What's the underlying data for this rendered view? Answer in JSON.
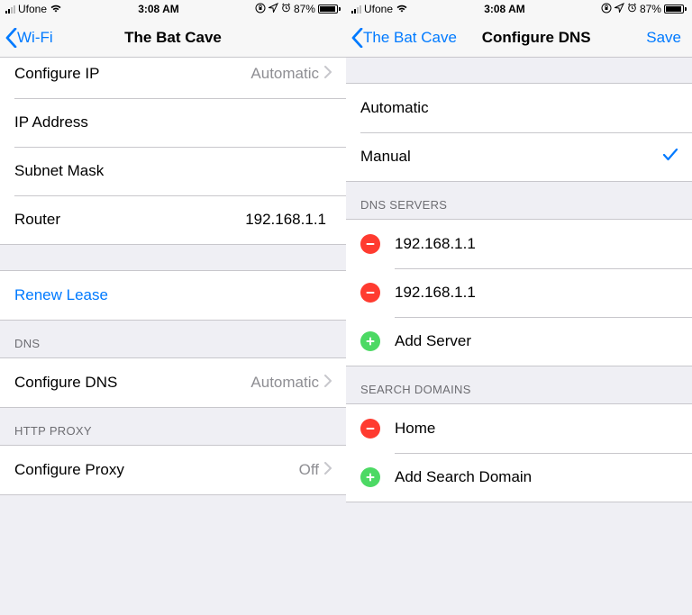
{
  "status": {
    "carrier": "Ufone",
    "time": "3:08 AM",
    "battery_pct": "87%"
  },
  "left": {
    "back_label": "Wi-Fi",
    "title": "The Bat Cave",
    "ipv4": {
      "configure_ip_label": "Configure IP",
      "configure_ip_value": "Automatic",
      "ip_address_label": "IP Address",
      "subnet_mask_label": "Subnet Mask",
      "router_label": "Router",
      "router_value": "192.168.1.1"
    },
    "renew_lease_label": "Renew Lease",
    "dns": {
      "header": "DNS",
      "configure_label": "Configure DNS",
      "configure_value": "Automatic"
    },
    "proxy": {
      "header": "HTTP PROXY",
      "configure_label": "Configure Proxy",
      "configure_value": "Off"
    }
  },
  "right": {
    "back_label": "The Bat Cave",
    "title": "Configure DNS",
    "save_label": "Save",
    "options": {
      "automatic_label": "Automatic",
      "manual_label": "Manual",
      "selected": "manual"
    },
    "dns_servers": {
      "header": "DNS SERVERS",
      "items": [
        "192.168.1.1",
        "192.168.1.1"
      ],
      "add_label": "Add Server"
    },
    "search_domains": {
      "header": "SEARCH DOMAINS",
      "items": [
        "Home"
      ],
      "add_label": "Add Search Domain"
    }
  }
}
